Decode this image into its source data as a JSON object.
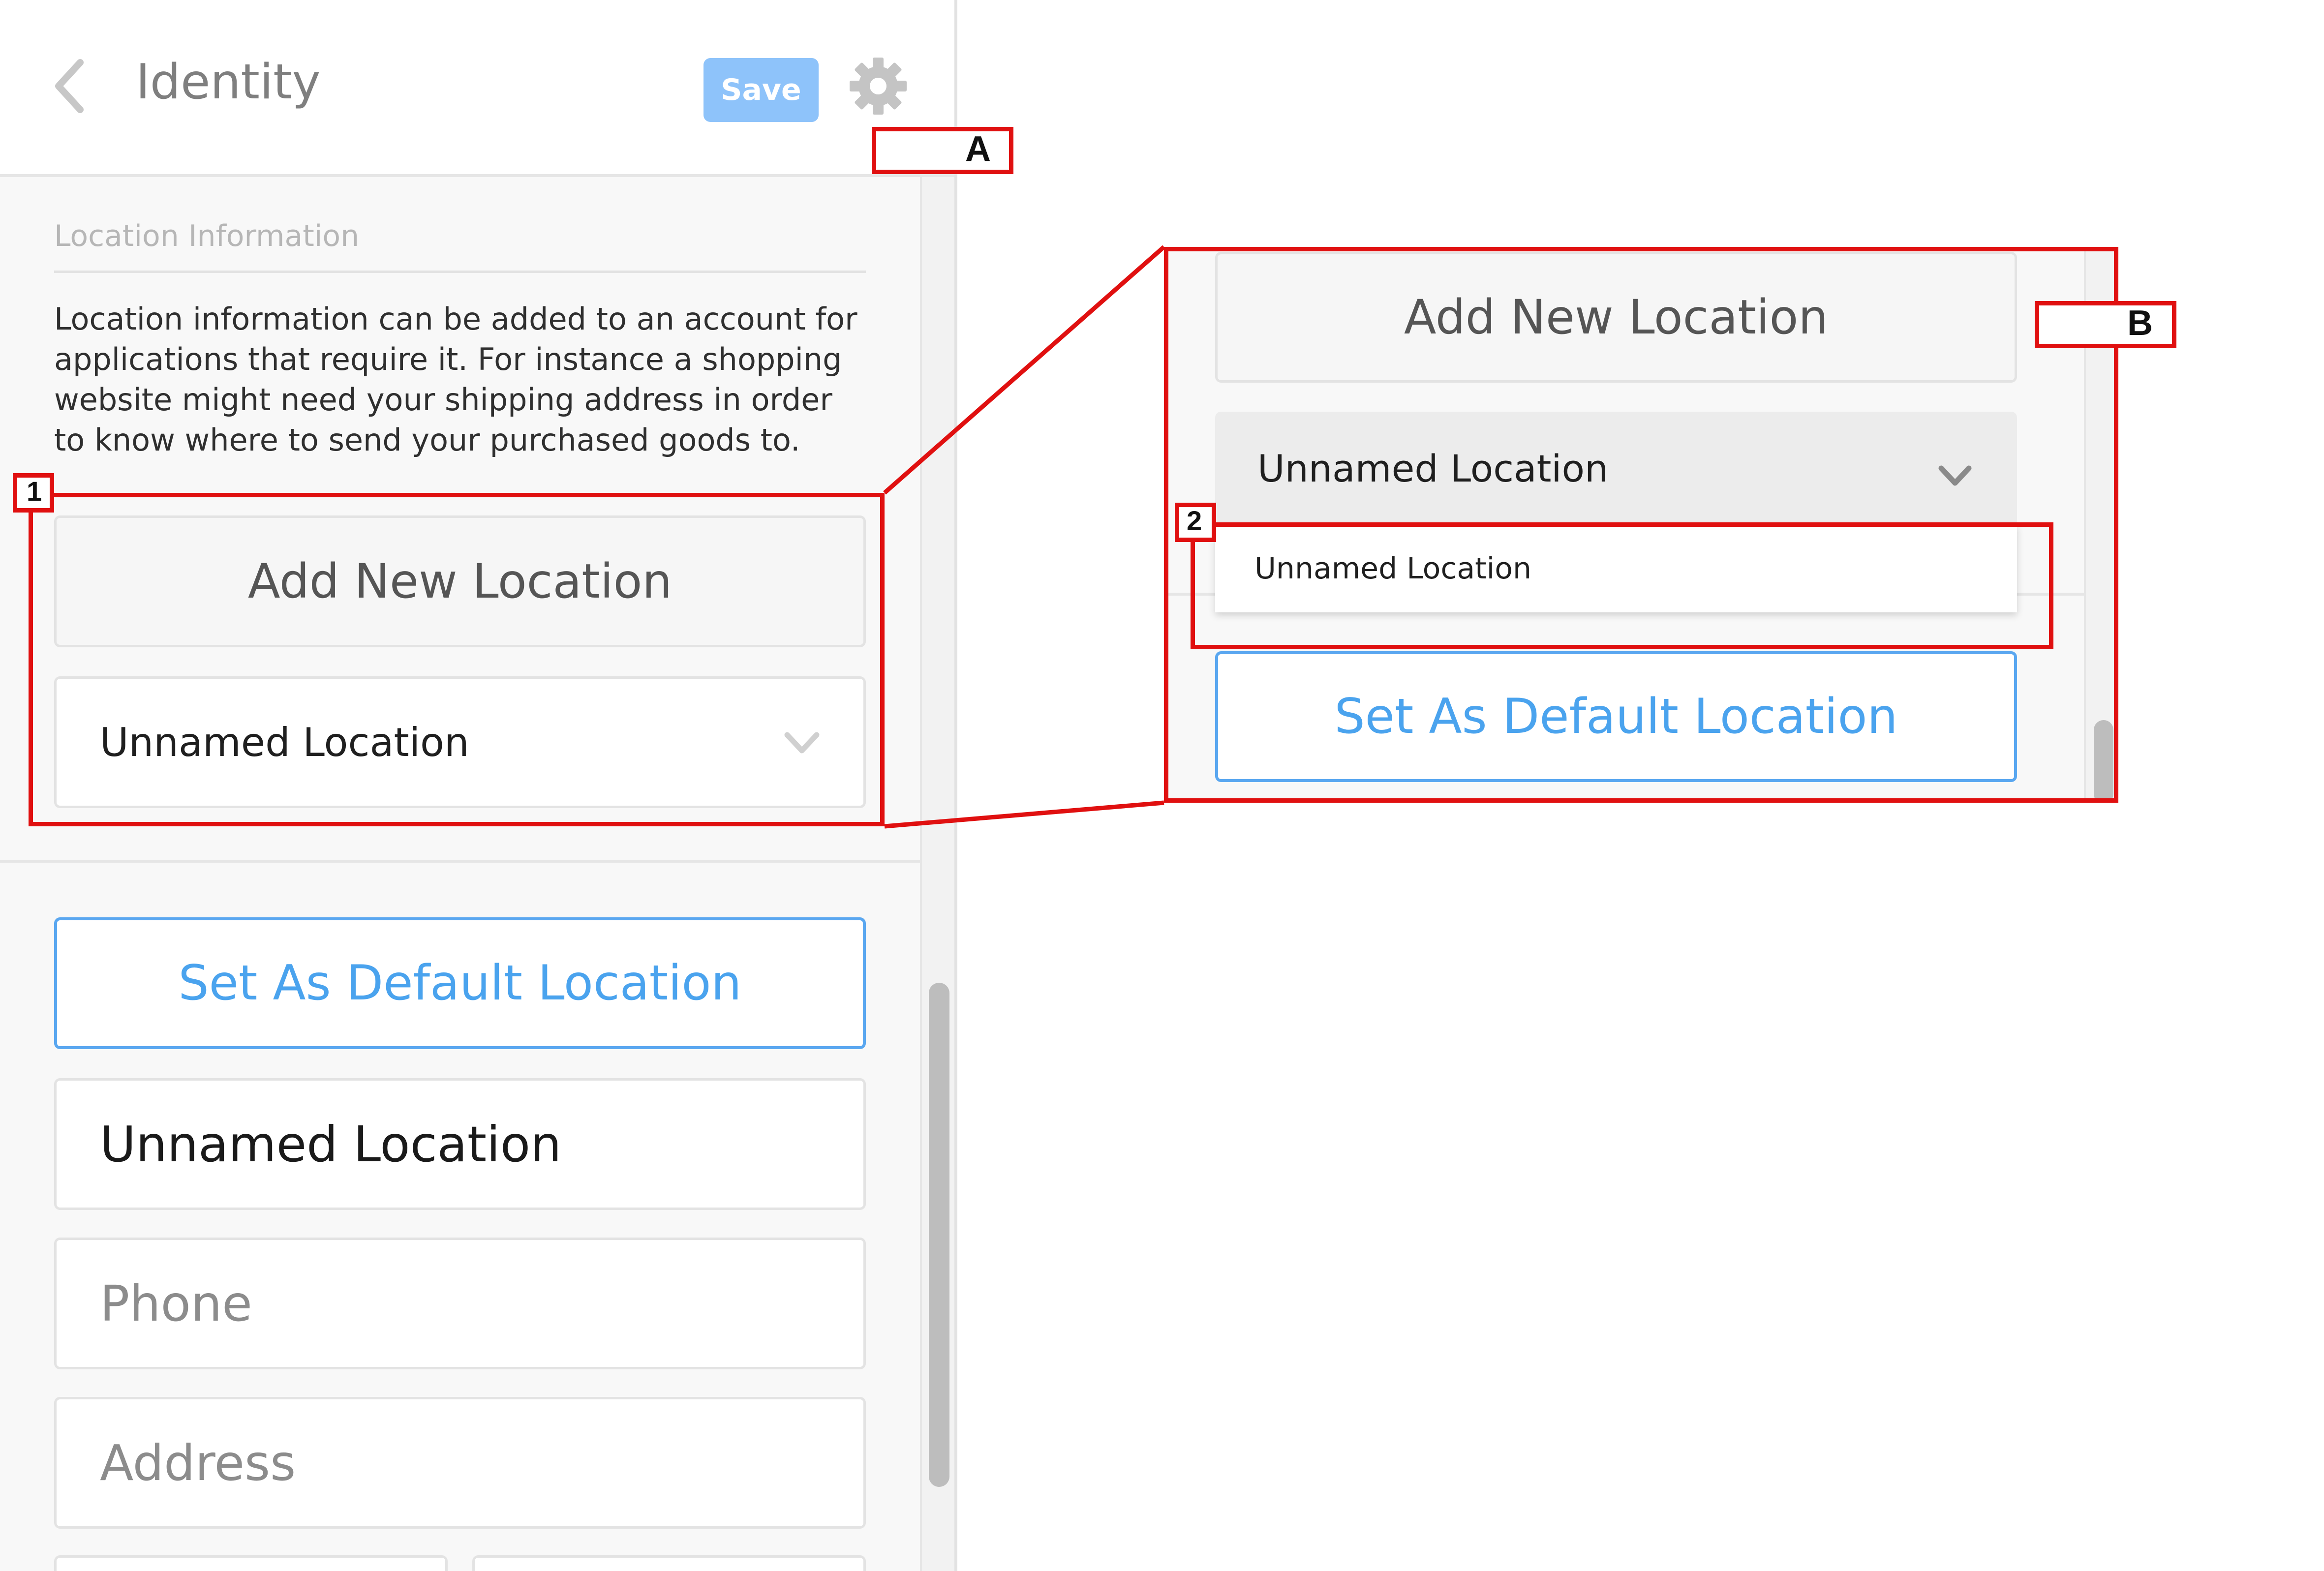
{
  "header": {
    "title": "Identity",
    "save_label": "Save"
  },
  "location_section": {
    "title": "Location Information",
    "description": "Location information can be added to an account for applications that require it. For instance a shopping website might need your shipping address in order to know where to send your purchased goods to.",
    "add_button_label": "Add New Location",
    "selected_location": "Unnamed Location",
    "set_default_label": "Set As Default Location"
  },
  "form": {
    "name_value": "Unnamed Location",
    "phone_placeholder": "Phone",
    "address_placeholder": "Address"
  },
  "zoom_callout": {
    "add_button_label": "Add New Location",
    "select_value": "Unnamed Location",
    "dropdown_option": "Unnamed Location",
    "set_default_label": "Set As Default Location"
  },
  "annotations": {
    "label_a": "A",
    "label_b": "B",
    "label_1": "1",
    "label_2": "2"
  },
  "colors": {
    "accent_blue": "#4aa3ee",
    "save_button": "#8ec3fa",
    "annotation_red": "#e01010"
  },
  "icons": [
    "back-chevron-icon",
    "gear-icon",
    "chevron-down-icon"
  ]
}
